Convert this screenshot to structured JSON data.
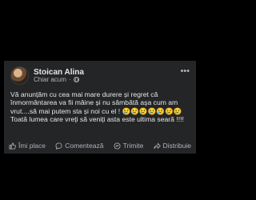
{
  "post": {
    "author": "Stoican Alina",
    "time": "Chiar acum",
    "time_separator": "·",
    "text": "Vă anunțăm cu cea mai mare durere și regret că înmormântarea va fii mâine și nu sâmbătă așa cum am vrut....să mai putem sta și noi cu el ! 😢😢😢😢😢😢😢 Toată lumea care vreți să veniți asta este ultima seară !!!!",
    "more_icon": "•••"
  },
  "actions": {
    "like": "Îmi place",
    "comment": "Comentează",
    "send": "Trimite",
    "share": "Distribuie"
  },
  "icons": {
    "like": "like-icon",
    "comment": "comment-icon",
    "send": "send-icon",
    "share": "share-icon",
    "privacy": "globe-icon"
  },
  "colors": {
    "background": "#000000",
    "card": "#242526",
    "text": "#e4e6eb",
    "secondary": "#b0b3b8"
  }
}
